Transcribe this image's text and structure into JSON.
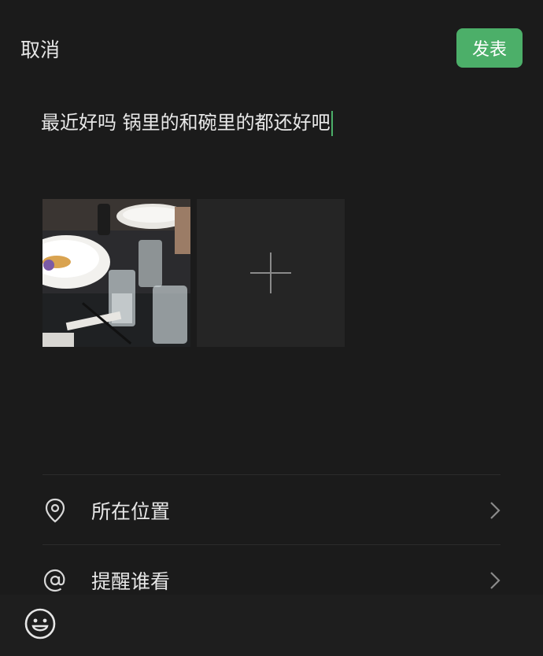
{
  "header": {
    "cancel_label": "取消",
    "publish_label": "发表"
  },
  "composer": {
    "text": "最近好吗 锅里的和碗里的都还好吧"
  },
  "photos": {
    "items": [
      {
        "description_icon": "photo-thumbnail"
      }
    ],
    "add_icon": "plus-icon"
  },
  "options": {
    "location": {
      "label": "所在位置",
      "icon": "location-pin-icon"
    },
    "remind": {
      "label": "提醒谁看",
      "icon": "at-icon"
    }
  },
  "bottom": {
    "emoji_icon": "emoji-icon"
  },
  "colors": {
    "accent": "#4caf69",
    "background": "#1b1b1b",
    "text": "#e8e8e8"
  }
}
